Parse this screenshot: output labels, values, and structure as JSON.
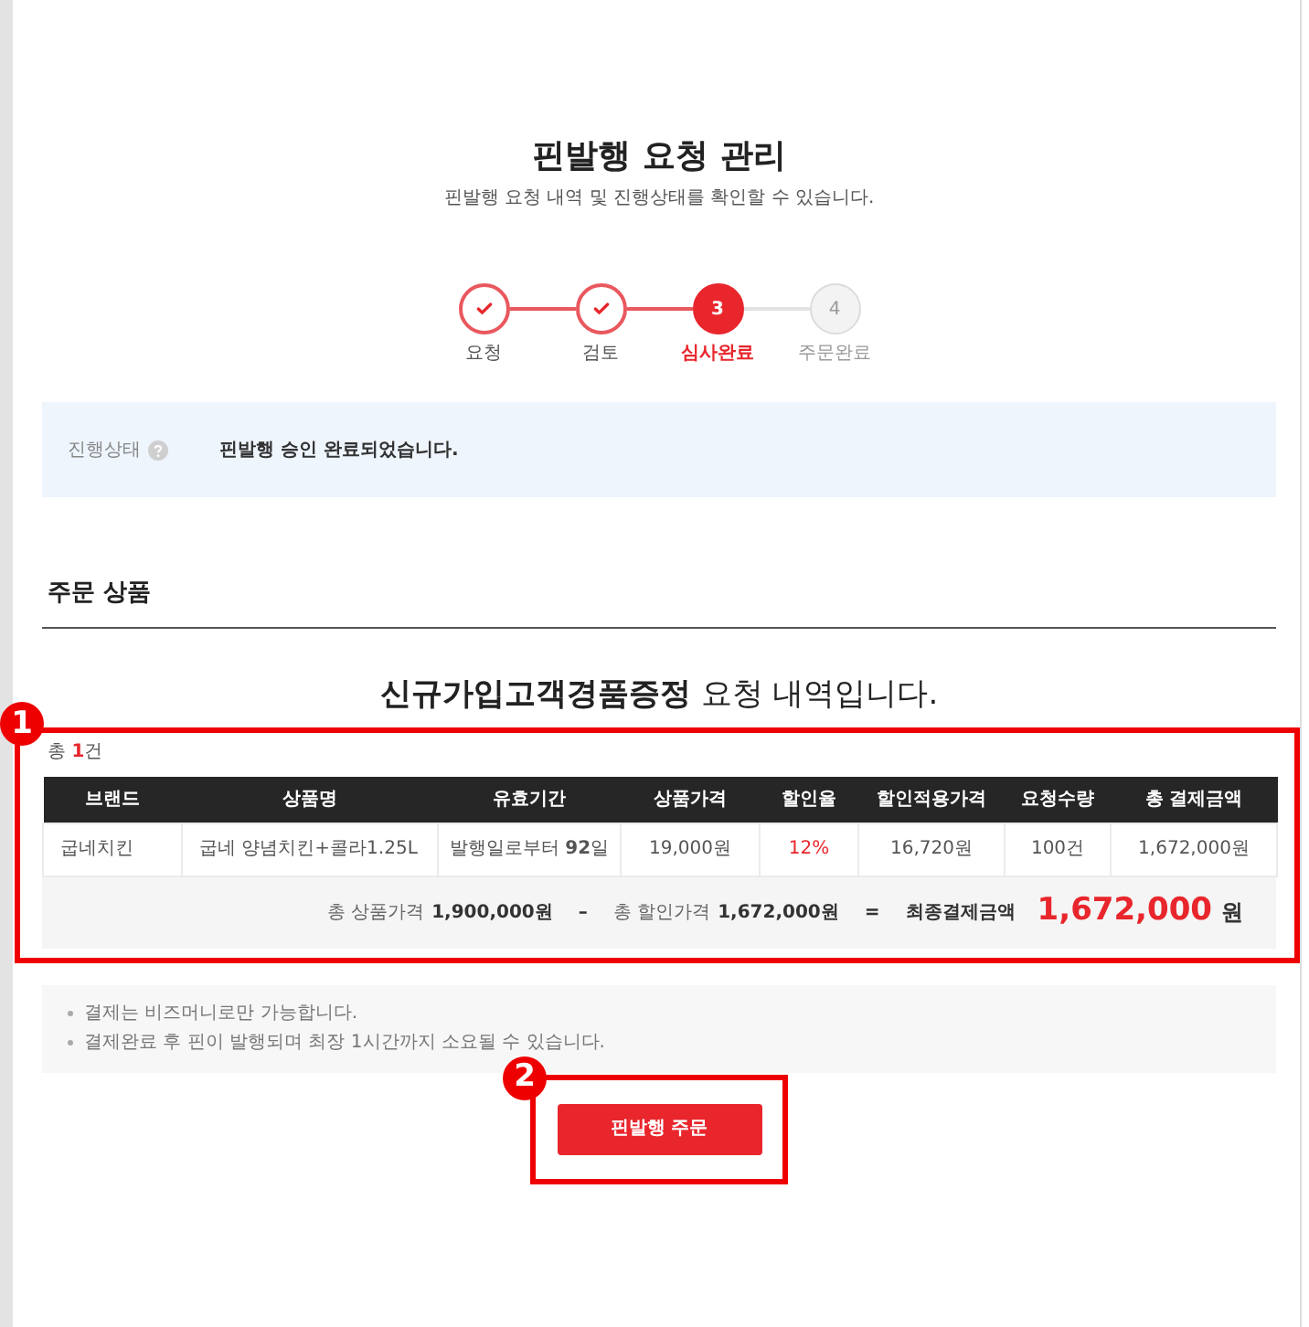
{
  "page": {
    "title": "핀발행 요청 관리",
    "subtitle": "핀발행 요청 내역 및 진행상태를 확인할 수 있습니다."
  },
  "steps": [
    {
      "label": "요청",
      "kind": "done"
    },
    {
      "label": "검토",
      "kind": "done"
    },
    {
      "number": "3",
      "label": "심사완료",
      "kind": "current"
    },
    {
      "number": "4",
      "label": "주문완료",
      "kind": "pending"
    }
  ],
  "status_panel": {
    "label": "진행상태",
    "message": "핀발행 승인 완료되었습니다."
  },
  "order_section": {
    "title": "주문 상품",
    "heading": "**신규가입고객경품증정** 요청 내역입니다.",
    "count": {
      "prefix": "총",
      "value": "1",
      "suffix": "건"
    },
    "table": {
      "columns": [
        {
          "label": "브랜드",
          "accent": false
        },
        {
          "label": "상품명",
          "accent": false
        },
        {
          "label": "유효기간",
          "accent": false
        },
        {
          "label": "상품가격",
          "accent": false
        },
        {
          "label": "할인율",
          "accent": true
        },
        {
          "label": "할인적용가격",
          "accent": false
        },
        {
          "label": "요청수량",
          "accent": false
        },
        {
          "label": "총 결제금액",
          "accent": false
        }
      ],
      "rows": [
        {
          "cells": [
            "굽네치킨",
            "굽네 양념치킨+콜라1.25L",
            "발행일로부터 **92**일",
            "19,000원",
            "12%",
            "16,720원",
            "100건",
            "1,672,000원"
          ]
        }
      ]
    },
    "summary": {
      "subtotal_label": "총 상품가격",
      "subtotal": "1,900,000원",
      "minus": "–",
      "discount_label": "총 할인가격",
      "discount": "1,672,000원",
      "equals": "=",
      "final_label": "최종결제금액",
      "final_amount": "1,672,000",
      "final_unit": "원"
    }
  },
  "notes": [
    "결제는 비즈머니로만 가능합니다.",
    "결제완료 후 핀이 발행되며 최장 1시간까지 소요될 수 있습니다."
  ],
  "order_button": {
    "label": "핀발행 주문"
  },
  "annotations": [
    {
      "number": "1"
    },
    {
      "number": "2"
    }
  ]
}
